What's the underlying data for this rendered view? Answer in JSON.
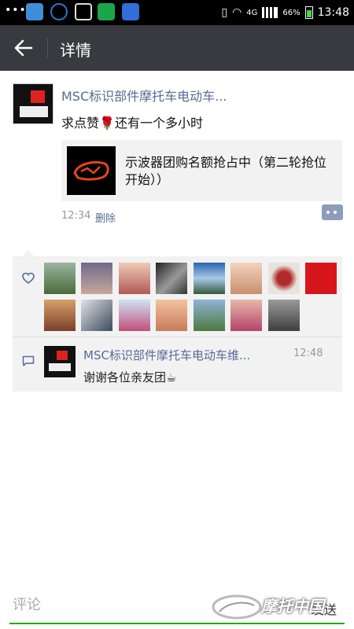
{
  "status_bar": {
    "dots": "•••",
    "network": "4G",
    "battery": "66%",
    "time": "13:48"
  },
  "header": {
    "title": "详情"
  },
  "post": {
    "author": "MSC标识部件摩托车电动车...",
    "text": "求点赞",
    "text_after": "还有一个多小时",
    "emoji_name": "rose-emoji",
    "link_title": "示波器团购名额抢占中（第二轮抢位开始））",
    "time": "12:34",
    "delete_label": "删除"
  },
  "likes": {
    "count_visible": 16
  },
  "comment": {
    "author": "MSC标识部件摩托车电动车维...",
    "time": "12:48",
    "text": "谢谢各位亲友团",
    "emoji_name": "coffee-emoji"
  },
  "input": {
    "placeholder": "评论",
    "send_label": "发送"
  },
  "watermark": {
    "text": "摩托中国"
  },
  "colors": {
    "header_bg": "#393a3f",
    "link_blue": "#576b95",
    "accent_green": "#1aad19"
  }
}
